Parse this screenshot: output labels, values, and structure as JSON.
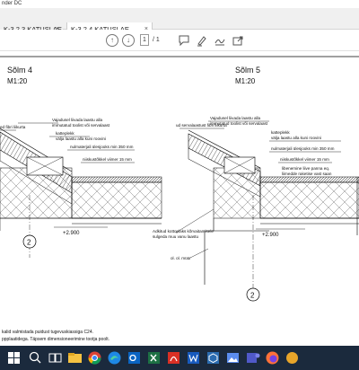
{
  "window": {
    "title_fragment": "nder DC"
  },
  "tabs": [
    {
      "label": "K-3.2.3 KATUSLAE ...",
      "close": "×"
    },
    {
      "label": "K-3.2.4 KATUSLAE ...",
      "close": "×"
    }
  ],
  "toolbar": {
    "current_page": "1",
    "page_count": "/ 1",
    "prev_symbol": "↑",
    "next_symbol": "↓"
  },
  "drawing": {
    "left_detail": {
      "title": "Sõlm 4",
      "scale": "M1:20"
    },
    "right_detail": {
      "title": "Sõlm 5",
      "scale": "M1:20"
    },
    "left_notes": [
      "Vajadusel liivada laastu alla",
      "immutatud toolist või servalaast",
      "katteplekk",
      "välja laastu alla kuni roovini",
      "nulmaterjali ülesjooks min 350 mm",
      "niiskustõkkel viimer 15 mm",
      "ed fibri liikurta"
    ],
    "right_notes": [
      "Vajadusel liivada laastu alla",
      "immutatud toolist või servalaast",
      "ud servalaastust fibri liikurta",
      "katteplekk",
      "välja laastu alla kuni roovini",
      "nulmaterjali ülesjooks min 350 mm",
      "niiskustõkkel viimer 15 mm",
      "libenemine liive panna eq.",
      "liimedde raketise vast saan",
      "Adkitud kottoplaks kõrvaitamisele",
      "sulgeda muu vanu laastu",
      "ol. ol. müür"
    ],
    "level_left": "+2.900",
    "level_right": "+2.900",
    "axis_label": "2",
    "bottom_note_1": "kalid valmistada puidust tugevuskiassiga C24.",
    "bottom_note_2": "ppplaatidega. Täpsem dimensioneerimine tootja poolt."
  },
  "taskbar_apps": [
    "windows",
    "search",
    "task-view",
    "explorer",
    "chrome",
    "edge",
    "outlook",
    "excel",
    "acrobat",
    "word",
    "3d",
    "photos",
    "teams",
    "firefox",
    "other"
  ]
}
